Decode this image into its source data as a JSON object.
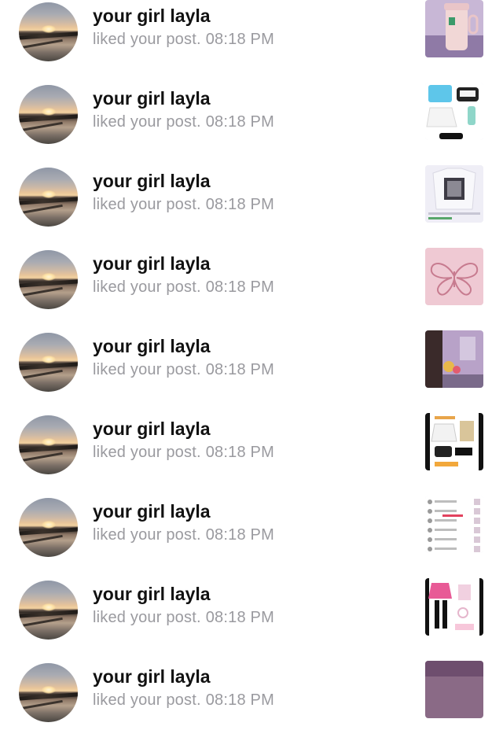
{
  "notifications": [
    {
      "user": "your girl layla",
      "action": "liked your post.",
      "time": "08:18 PM",
      "thumb": "tumbler-cup"
    },
    {
      "user": "your girl layla",
      "action": "liked your post.",
      "time": "08:18 PM",
      "thumb": "outfit-blue-top"
    },
    {
      "user": "your girl layla",
      "action": "liked your post.",
      "time": "08:18 PM",
      "thumb": "graphic-tee"
    },
    {
      "user": "your girl layla",
      "action": "liked your post.",
      "time": "08:18 PM",
      "thumb": "pink-butterfly"
    },
    {
      "user": "your girl layla",
      "action": "liked your post.",
      "time": "08:18 PM",
      "thumb": "purple-room"
    },
    {
      "user": "your girl layla",
      "action": "liked your post.",
      "time": "08:18 PM",
      "thumb": "outfit-collage"
    },
    {
      "user": "your girl layla",
      "action": "liked your post.",
      "time": "08:18 PM",
      "thumb": "notification-list"
    },
    {
      "user": "your girl layla",
      "action": "liked your post.",
      "time": "08:18 PM",
      "thumb": "pink-outfit"
    },
    {
      "user": "your girl layla",
      "action": "liked your post.",
      "time": "08:18 PM",
      "thumb": "purple-photo"
    }
  ]
}
